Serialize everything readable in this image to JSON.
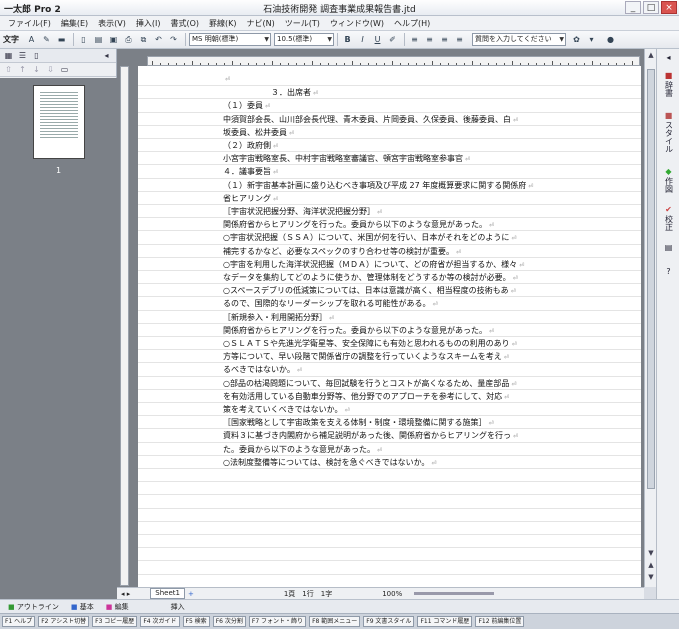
{
  "titlebar": {
    "app_name": "一太郎 Pro 2",
    "doc_title": "石油技術開発 調査事業成果報告書.jtd"
  },
  "menu": {
    "items": [
      "ファイル(F)",
      "編集(E)",
      "表示(V)",
      "挿入(I)",
      "書式(O)",
      "罫線(K)",
      "ナビ(N)",
      "ツール(T)",
      "ウィンドウ(W)",
      "ヘルプ(H)"
    ]
  },
  "toolbar": {
    "label": "文字",
    "font_name": "MS 明朝(標準)",
    "font_size": "10.5(標準)",
    "question_placeholder": "質問を入力してください"
  },
  "leftpanel": {
    "page_number": "1"
  },
  "document": {
    "lines": [
      "",
      "　　　　　　３．出席者",
      "（１）委員",
      "中須賀部会長、山川部会長代理、青木委員、片岡委員、久保委員、後藤委員、白",
      "坂委員、松井委員",
      "（２）政府側",
      "小宮宇宙戦略室長、中村宇宙戦略室審議官、頓宮宇宙戦略室参事官",
      "４．議事要旨",
      "（１）新宇宙基本計画に盛り込むべき事項及び平成 27 年度概算要求に関する関係府",
      "省ヒアリング",
      "［宇宙状況把握分野、海洋状況把握分野］",
      "関係府省からヒアリングを行った。委員から以下のような意見があった。",
      "○宇宙状況把握（ＳＳＡ）について、米国が何を行い、日本がそれをどのように",
      "補完するかなど、必要なスペックのすり合わせ等の検討が重要。",
      "○宇宙を利用した海洋状況把握（ＭＤＡ）について、どの府省が担当するか、様々",
      "なデータを集約してどのように使うか、管理体制をどうするか等の検討が必要。",
      "○スペースデブリの低減策については、日本は意識が高く、相当程度の技術もあ",
      "るので、国際的なリーダーシップを取れる可能性がある。",
      "［新規参入・利用開拓分野］",
      "関係府省からヒアリングを行った。委員から以下のような意見があった。",
      "○ＳＬＡＴＳや先進光学衛星等、安全保障にも有効と思われるものの利用のあり",
      "方等について、早い段階で関係省庁の調整を行っていくようなスキームを考え",
      "るべきではないか。",
      "○部品の枯渇問題について、毎回試験を行うとコストが高くなるため、量産部品",
      "を有効活用している自動車分野等、他分野でのアプローチを参考にして、対応",
      "策を考えていくべきではないか。",
      "［国家戦略として宇宙政策を支える体制・制度・環境整備に関する施策］",
      "資料３に基づき内閣府から補足説明があった後、関係府省からヒアリングを行っ",
      "た。委員から以下のような意見があった。",
      "○法制度整備等については、検討を急ぐべきではないか。"
    ]
  },
  "palette": {
    "items": [
      "辞書",
      "スタイル",
      "作図",
      "校正",
      "?"
    ]
  },
  "hscroll": {
    "sheet": "Sheet1",
    "status": "1頁　1行　1字",
    "zoom": "100%"
  },
  "viewbar": {
    "items": [
      "アウトライン",
      "基本",
      "編集",
      "挿入"
    ]
  },
  "funcbar": {
    "keys": [
      "F1 ヘルプ",
      "F2 アシスト切替",
      "F3 コピー履歴",
      "F4 次ガイド",
      "F5 検索",
      "F6 次分割",
      "F7 フォント・飾り",
      "F8 範囲メニュー",
      "F9 文書スタイル",
      "F11 コマンド履歴",
      "F12 前編集位置"
    ]
  }
}
